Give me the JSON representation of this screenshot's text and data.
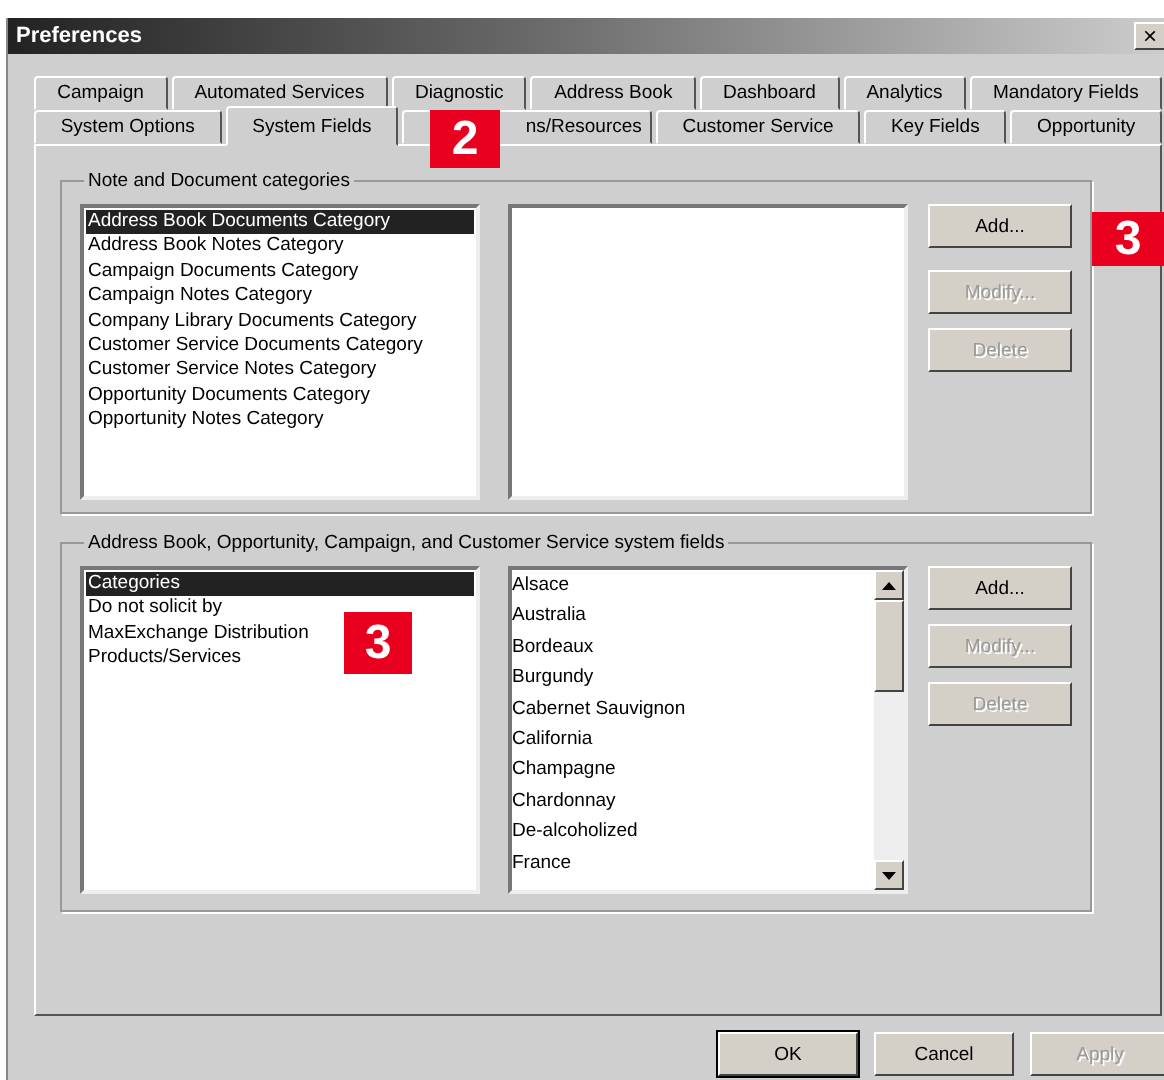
{
  "window": {
    "title": "Preferences",
    "close": "×"
  },
  "tab_rows": [
    [
      {
        "label": "Campaign",
        "selected": false
      },
      {
        "label": "Automated Services",
        "selected": false
      },
      {
        "label": "Diagnostic",
        "selected": false
      },
      {
        "label": "Address Book",
        "selected": false
      },
      {
        "label": "Dashboard",
        "selected": false
      },
      {
        "label": "Analytics",
        "selected": false
      },
      {
        "label": "Mandatory Fields",
        "selected": false
      }
    ],
    [
      {
        "label": "System Options",
        "selected": false
      },
      {
        "label": "System Fields",
        "selected": true
      },
      {
        "label": "ns/Resources",
        "selected": false,
        "covered": true
      },
      {
        "label": "Customer Service",
        "selected": false
      },
      {
        "label": "Key Fields",
        "selected": false
      },
      {
        "label": "Opportunity",
        "selected": false
      }
    ]
  ],
  "callouts": [
    {
      "text": "2"
    },
    {
      "text": "3"
    },
    {
      "text": "3"
    }
  ],
  "groups": [
    {
      "title": "Note and Document categories",
      "list": [
        {
          "text": "Address Book Documents Category",
          "selected": true
        },
        {
          "text": "Address Book Notes Category",
          "selected": false
        },
        {
          "text": "Campaign Documents Category",
          "selected": false
        },
        {
          "text": "Campaign Notes Category",
          "selected": false
        },
        {
          "text": "Company Library Documents Category",
          "selected": false
        },
        {
          "text": "Customer Service Documents Category",
          "selected": false
        },
        {
          "text": "Customer Service Notes Category",
          "selected": false
        },
        {
          "text": "Opportunity Documents Category",
          "selected": false
        },
        {
          "text": "Opportunity Notes Category",
          "selected": false
        }
      ],
      "buttons": [
        {
          "label": "Add...",
          "disabled": false
        },
        {
          "label": "Modify...",
          "disabled": true
        },
        {
          "label": "Delete",
          "disabled": true
        }
      ]
    },
    {
      "title": "Address Book, Opportunity, Campaign, and Customer Service system fields",
      "list": [
        {
          "text": "Categories",
          "selected": true
        },
        {
          "text": "Do not solicit by",
          "selected": false
        },
        {
          "text": "MaxExchange Distribution",
          "selected": false
        },
        {
          "text": "Products/Services",
          "selected": false
        }
      ],
      "values": [
        "Alsace",
        "Australia",
        "Bordeaux",
        "Burgundy",
        "Cabernet Sauvignon",
        "California",
        "Champagne",
        "Chardonnay",
        "De-alcoholized",
        "France"
      ],
      "buttons": [
        {
          "label": "Add...",
          "disabled": false
        },
        {
          "label": "Modify...",
          "disabled": true
        },
        {
          "label": "Delete",
          "disabled": true
        }
      ]
    }
  ],
  "footer_buttons": [
    {
      "label": "OK",
      "disabled": false,
      "default": true
    },
    {
      "label": "Cancel",
      "disabled": false,
      "default": false
    },
    {
      "label": "Apply",
      "disabled": true,
      "default": false
    }
  ]
}
